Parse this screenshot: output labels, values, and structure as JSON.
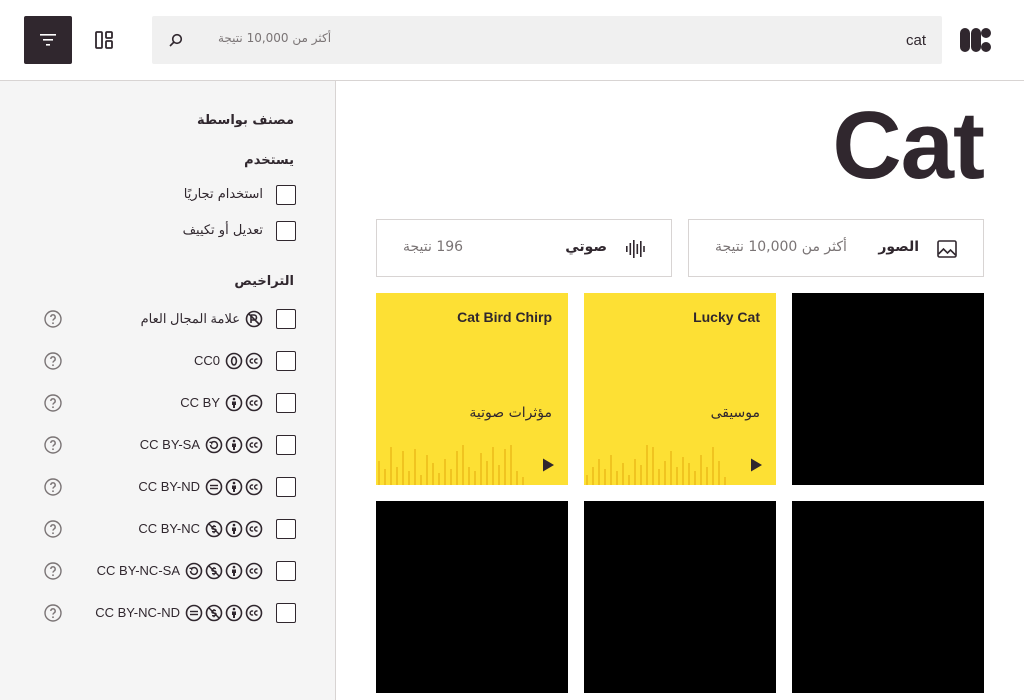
{
  "header": {
    "search_value": "cat",
    "search_count": "أكثر من 10,000 نتيجة",
    "icons": {
      "filter": "filter-icon",
      "layout": "layout-icon",
      "search": "search-icon",
      "logo": "openverse-logo-icon"
    }
  },
  "sidebar": {
    "sort_heading": "مصنف بواسطة",
    "use_heading": "يستخدم",
    "use_filters": [
      {
        "label": "استخدام تجاريًا"
      },
      {
        "label": "تعديل أو تكييف"
      }
    ],
    "license_heading": "التراخيص",
    "licenses": [
      {
        "label": "علامة المجال العام",
        "icons": [
          "pd-icon"
        ]
      },
      {
        "label": "CC0",
        "icons": [
          "cc-icon",
          "zero-icon"
        ]
      },
      {
        "label": "CC BY",
        "icons": [
          "cc-icon",
          "by-icon"
        ]
      },
      {
        "label": "CC BY-SA",
        "icons": [
          "cc-icon",
          "by-icon",
          "sa-icon"
        ]
      },
      {
        "label": "CC BY-ND",
        "icons": [
          "cc-icon",
          "by-icon",
          "nd-icon"
        ]
      },
      {
        "label": "CC BY-NC",
        "icons": [
          "cc-icon",
          "by-icon",
          "nc-icon"
        ]
      },
      {
        "label": "CC BY-NC-SA",
        "icons": [
          "cc-icon",
          "by-icon",
          "nc-icon",
          "sa-icon"
        ]
      },
      {
        "label": "CC BY-NC-ND",
        "icons": [
          "cc-icon",
          "by-icon",
          "nc-icon",
          "nd-icon"
        ]
      }
    ]
  },
  "main": {
    "title": "Cat",
    "type_cards": [
      {
        "label": "الصور",
        "count": "أكثر من 10,000 نتيجة",
        "icon": "image-icon"
      },
      {
        "label": "صوتي",
        "count": "196 نتيجة",
        "icon": "audio-wave-icon"
      }
    ],
    "audio_tiles": [
      {
        "title": "Cat Bird Chirp",
        "category": "مؤثرات صوتية"
      },
      {
        "title": "Lucky Cat",
        "category": "موسيقى"
      }
    ]
  },
  "colors": {
    "dark": "#30272e",
    "audio_tile": "#fde034",
    "sidebar_bg": "#f5f5f5",
    "search_bg": "#f0f0f0"
  }
}
